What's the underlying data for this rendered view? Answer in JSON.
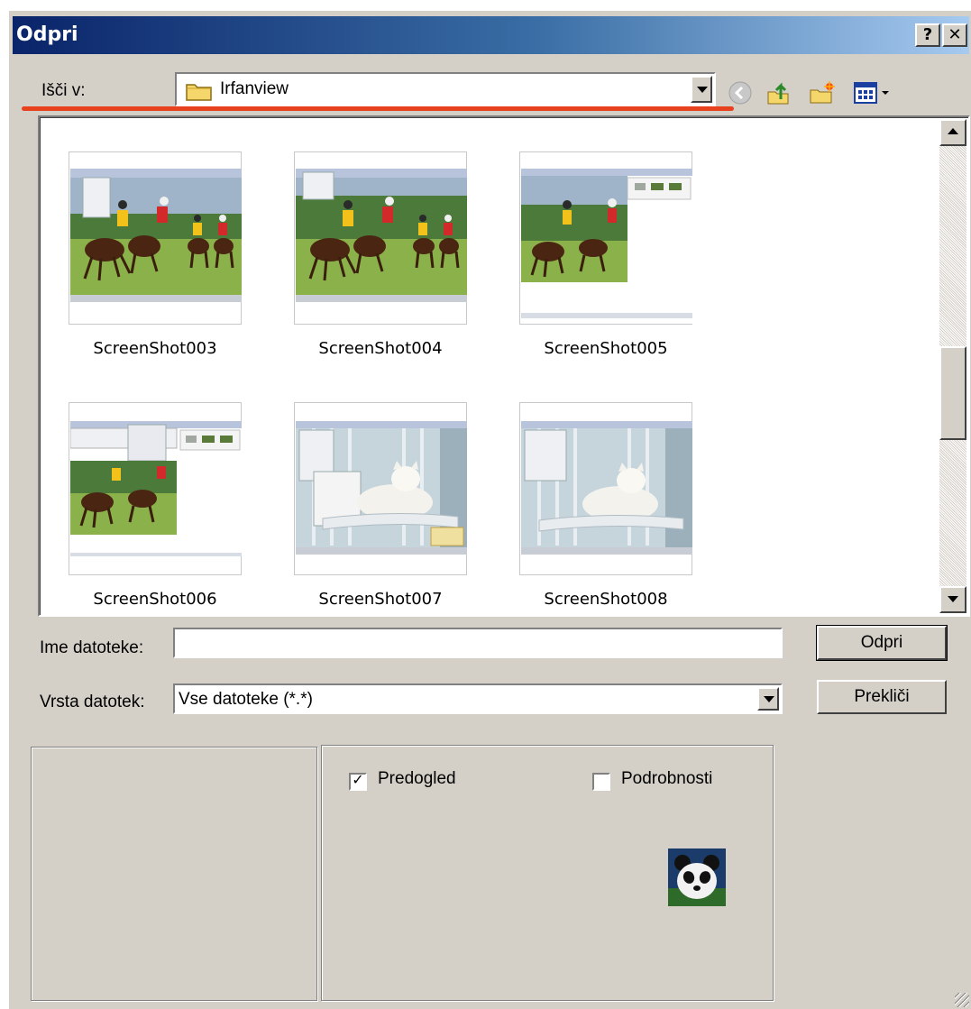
{
  "window": {
    "title": "Odpri",
    "help_button": "?",
    "close_button": "✕"
  },
  "lookin": {
    "label": "Išči v:",
    "value": "Irfanview"
  },
  "toolbar": {
    "icons": [
      "back-icon",
      "up-folder-icon",
      "new-folder-icon",
      "view-menu-icon"
    ]
  },
  "files": [
    {
      "name": "ScreenShot003",
      "kind": "polo"
    },
    {
      "name": "ScreenShot004",
      "kind": "polo"
    },
    {
      "name": "ScreenShot005",
      "kind": "polo-small"
    },
    {
      "name": "ScreenShot006",
      "kind": "polo-small"
    },
    {
      "name": "ScreenShot007",
      "kind": "cat"
    },
    {
      "name": "ScreenShot008",
      "kind": "cat"
    }
  ],
  "filename": {
    "label": "Ime datoteke:",
    "value": ""
  },
  "filetype": {
    "label": "Vrsta datotek:",
    "value": "Vse datoteke (*.*)"
  },
  "buttons": {
    "open": "Odpri",
    "cancel": "Prekliči"
  },
  "options": {
    "preview_label": "Predogled",
    "preview_checked": true,
    "details_label": "Podrobnosti",
    "details_checked": false
  },
  "colors": {
    "titlebar_start": "#0a246a",
    "titlebar_end": "#a6caf0",
    "dialog_face": "#d4d0c8",
    "highlight_underline": "#e8411d"
  }
}
